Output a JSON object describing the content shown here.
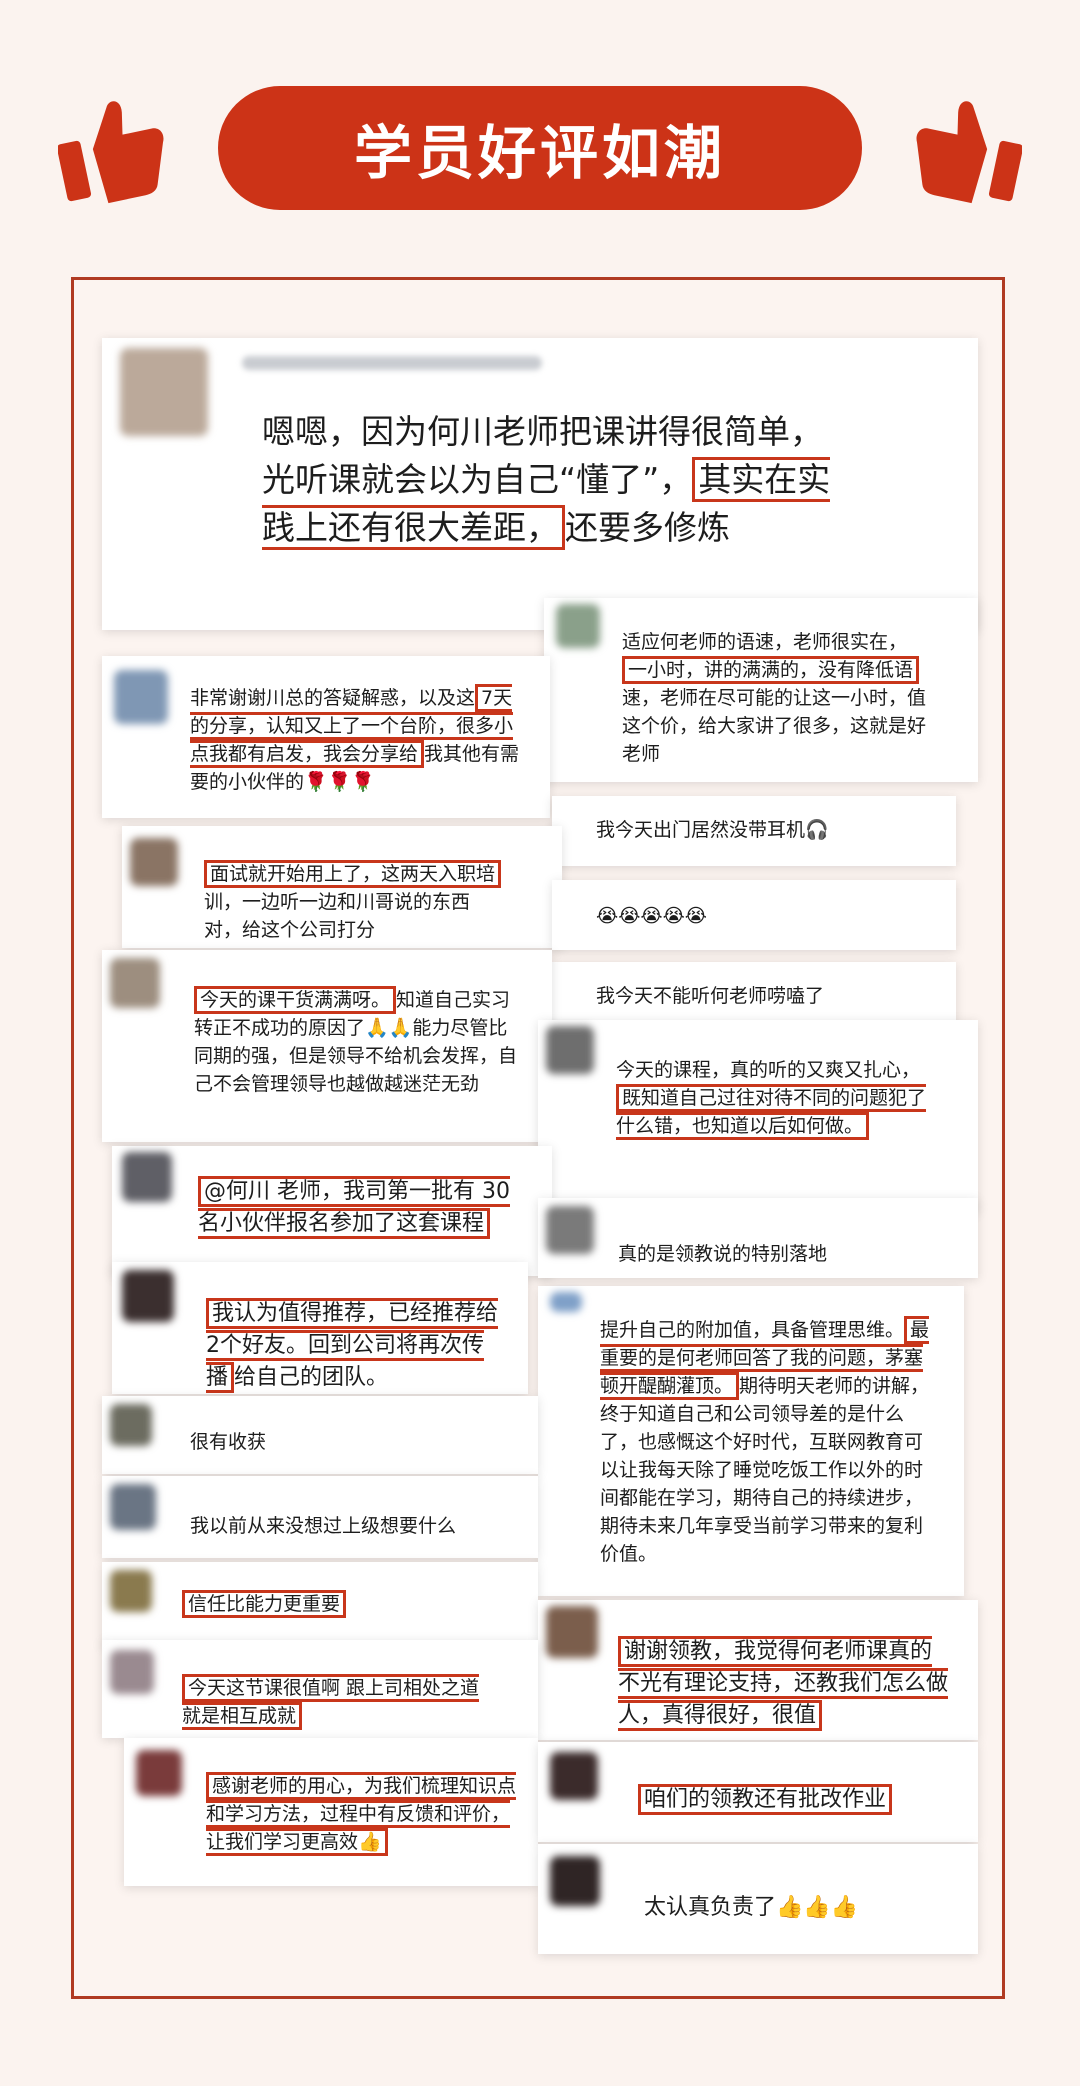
{
  "header": {
    "title": "学员好评如潮",
    "left_icon": "thumbs-up-icon",
    "right_icon": "thumbs-up-icon",
    "accent": "#cc3317"
  },
  "reviews": {
    "r1": {
      "before": "嗯嗯，因为何川老师把课讲得很简单，光听课就会以为自己“懂了”，",
      "highlight": "其实在实践上还有很大差距，",
      "after": "还要多修炼"
    },
    "r2": {
      "before": "适应何老师的语速，老师很实在，",
      "highlight": "一小时，讲的满满的，没有降低语",
      "after": "速，老师在尽可能的让这一小时，值这个价，给大家讲了很多，这就是好老师"
    },
    "r3": {
      "before": "非常谢谢川总的答疑解惑，以及这",
      "highlight": "7天的分享，认知又上了一个台阶，很多小点我都有启发，我会分享给",
      "after": "我其他有需要的小伙伴的🌹🌹🌹"
    },
    "r4": {
      "text": "我今天出门居然没带耳机🎧"
    },
    "r5": {
      "highlight": "面试就开始用上了，这两天入职培",
      "after": "训，一边听一边和川哥说的东西对，给这个公司打分"
    },
    "r6": {
      "text": "😭😭😭😭😭"
    },
    "r7": {
      "text": "我今天不能听何老师唠嗑了"
    },
    "r8": {
      "highlight": "今天的课干货满满呀。",
      "after": "知道自己实习转正不成功的原因了🙏🙏能力尽管比同期的强，但是领导不给机会发挥，自己不会管理领导也越做越迷茫无劲"
    },
    "r9": {
      "before": "今天的课程，真的听的又爽又扎心，",
      "highlight": "既知道自己过往对待不同的问题犯了什么错，也知道以后如何做。"
    },
    "r10": {
      "highlight": "@何川 老师，我司第一批有 30 名小伙伴报名参加了这套课程"
    },
    "r11": {
      "text": "真的是领教说的特别落地"
    },
    "r12": {
      "highlight": "我认为值得推荐，已经推荐给2个好友。回到公司将再次传播",
      "after": "给自己的团队。"
    },
    "r13": {
      "before": "提升自己的附加值，具备管理思维。",
      "highlight": "最重要的是何老师回答了我的问题，茅塞顿开醍醐灌顶。",
      "after": "期待明天老师的讲解，终于知道自己和公司领导差的是什么了，也感慨这个好时代，互联网教育可以让我每天除了睡觉吃饭工作以外的时间都能在学习，期待自己的持续进步，期待未来几年享受当前学习带来的复利价值。"
    },
    "r14": {
      "text": "很有收获"
    },
    "r15": {
      "text": "我以前从来没想过上级想要什么"
    },
    "r16": {
      "highlight": "信任比能力更重要"
    },
    "r17": {
      "highlight": "谢谢领教，我觉得何老师课真的不光有理论支持，还教我们怎么做人，真得很好，很值"
    },
    "r18": {
      "highlight": "今天这节课很值啊 跟上司相处之道 就是相互成就"
    },
    "r19": {
      "highlight": "感谢老师的用心，为我们梳理知识点和学习方法，过程中有反馈和评价，让我们学习更高效👍"
    },
    "r20": {
      "highlight": "咱们的领教还有批改作业"
    },
    "r21": {
      "text": "太认真负责了👍👍👍"
    }
  }
}
